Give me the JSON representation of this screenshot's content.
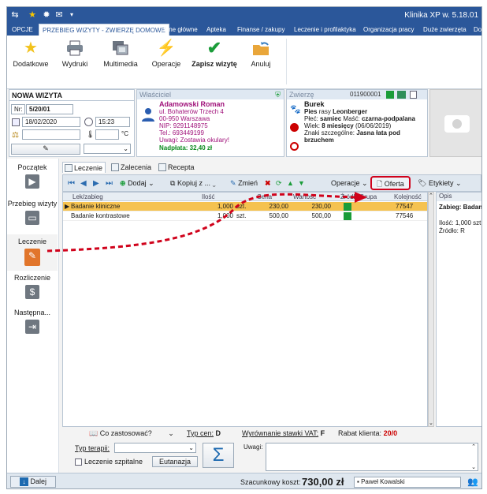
{
  "app": {
    "title": "Klinika XP w. 5.18.01",
    "quick_icons": [
      "app-icon",
      "star-icon",
      "gear-icon",
      "mail-icon",
      "dropdown-icon"
    ]
  },
  "ribbon_tabs": [
    {
      "label": "OPCJE",
      "active": false
    },
    {
      "label": "PRZEBIEG WIZYTY - ZWIERZĘ DOMOWE",
      "active": true
    },
    {
      "label": "Dane główne",
      "active": false
    },
    {
      "label": "Apteka",
      "active": false
    },
    {
      "label": "Finanse / zakupy",
      "active": false
    },
    {
      "label": "Leczenie i profilaktyka",
      "active": false
    },
    {
      "label": "Organizacja pracy",
      "active": false
    },
    {
      "label": "Duże zwierzęta",
      "active": false
    },
    {
      "label": "Do",
      "active": false
    }
  ],
  "ribbon": {
    "dodatkowe": "Dodatkowe",
    "wydruki": "Wydruki",
    "multimedia": "Multimedia",
    "operacje": "Operacje",
    "zapisz": "Zapisz wizytę",
    "anuluj": "Anuluj"
  },
  "visit": {
    "title": "NOWA WIZYTA",
    "nr_label": "Nr:",
    "nr_value": "5/20/01",
    "date": "18/02/2020",
    "time": "15:23",
    "temp_unit": "°C"
  },
  "owner": {
    "header": "Właściciel",
    "name": "Adamowski Roman",
    "street": "ul. Bohaterów Trzech 4",
    "city": "00-950  Warszawa",
    "nip": "NIP: 9291148975",
    "tel": "Tel.: 693449199",
    "uwagi": "Uwagi: Zostawia okulary!",
    "nadplata": "Nadpłata: 32,40 zł"
  },
  "animal": {
    "header": "Zwierzę",
    "id": "011900001",
    "name": "Burek",
    "species_prefix": "Pies",
    "species_mid": "rasy",
    "breed": "Leonberger",
    "sex_label": "Płeć:",
    "sex": "samiec",
    "color_label": "Maść:",
    "color": "czarna-podpalana",
    "age_label": "Wiek:",
    "age": "8 miesięcy",
    "dob": "(06/06/2019)",
    "marks_label": "Znaki szczególne:",
    "marks": "Jasna łata pod brzuchem"
  },
  "nav": [
    {
      "label": "Początek",
      "active": false,
      "icon": "play-doc-icon"
    },
    {
      "label": "Przebieg wizyty",
      "active": false,
      "icon": "bag-icon"
    },
    {
      "label": "Leczenie",
      "active": true,
      "icon": "clipboard-icon"
    },
    {
      "label": "Rozliczenie",
      "active": false,
      "icon": "money-icon"
    },
    {
      "label": "Następna...",
      "active": false,
      "icon": "next-icon"
    }
  ],
  "subtabs": [
    "Leczenie",
    "Zalecenia",
    "Recepta"
  ],
  "toolbar": {
    "dodaj": "Dodaj",
    "kopiuj": "Kopiuj z ...",
    "zmien": "Zmień",
    "operacje": "Operacje",
    "oferta": "Oferta",
    "etykiety": "Etykiety"
  },
  "grid": {
    "headers": [
      "Lek/zabieg",
      "Ilość",
      "Cena",
      "Wartość",
      "Źródło",
      "Grupa",
      "Kolejność"
    ],
    "rows": [
      {
        "name": "Badanie kliniczne",
        "qty": "1,000",
        "unit": "szt.",
        "price": "230,00",
        "value": "230,00",
        "order": "77547",
        "selected": true
      },
      {
        "name": "Badanie kontrastowe",
        "qty": "1,000",
        "unit": "szt.",
        "price": "500,00",
        "value": "500,00",
        "order": "77546",
        "selected": false
      }
    ]
  },
  "opis": {
    "header": "Opis",
    "title": "Zabieg: Badan",
    "line1": "Ilość: 1,000 szt.",
    "line2": "Źródło: R"
  },
  "statusline": {
    "co": "Co zastosować?",
    "typ_cen_label": "Typ cen:",
    "typ_cen": "D",
    "vat_label": "Wyrównanie stawki VAT:",
    "vat": "F",
    "rabat_label": "Rabat klienta:",
    "rabat": "20/0"
  },
  "bottom": {
    "typ_terapii": "Typ terapii:",
    "leczenie_szpitalne": "Leczenie szpitalne",
    "eutanazja": "Eutanazja",
    "uwagi": "Uwagi:"
  },
  "statusbar": {
    "dalej": "Dalej",
    "koszt_label": "Szacunkowy koszt:",
    "koszt": "730,00 zł",
    "user": "Paweł Kowalski"
  },
  "colors": {
    "ribbon_blue": "#2b579a",
    "selected_row": "#f5c250",
    "highlight_red": "#d0021b",
    "purple": "#a0127a",
    "green": "#0b8a1e"
  }
}
